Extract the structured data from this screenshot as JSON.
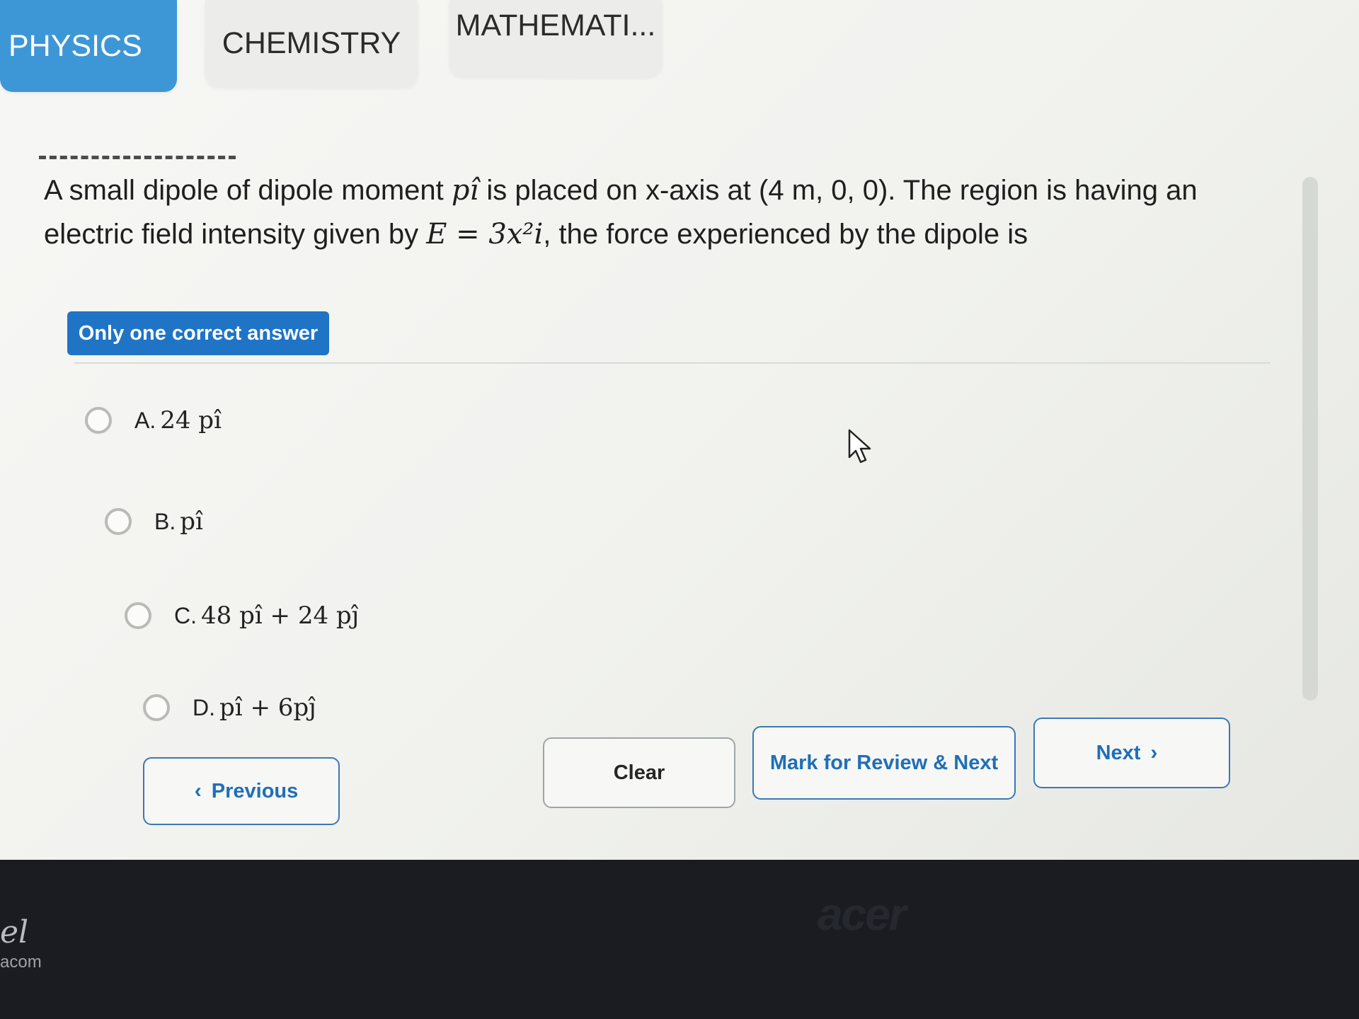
{
  "tabs": [
    {
      "label": "PHYSICS",
      "active": true
    },
    {
      "label": "CHEMISTRY",
      "active": false
    },
    {
      "label": "MATHEMATI...",
      "active": false
    }
  ],
  "question": {
    "text_1": "A small dipole of dipole moment ",
    "math_1": "pî",
    "text_2": " is placed on x-axis at (4 m, 0, 0). The region is having an electric field intensity given by ",
    "math_2": "E = 3x²i",
    "text_3": ", the force experienced by the dipole is"
  },
  "answer_type": "Only one correct answer",
  "options": [
    {
      "letter": "A.",
      "text": "24 pî"
    },
    {
      "letter": "B.",
      "text": "pî"
    },
    {
      "letter": "C.",
      "text": "48 pî + 24 pĵ"
    },
    {
      "letter": "D.",
      "text": "pî + 6pĵ"
    }
  ],
  "buttons": {
    "previous": "Previous",
    "clear": "Clear",
    "mark_review": "Mark for Review & Next",
    "next": "Next"
  },
  "bezel": {
    "brand": "acer",
    "sticker_top": "el",
    "sticker_bottom": "acom"
  },
  "colors": {
    "accent": "#3d97d6",
    "badge": "#1f74c6",
    "button_text": "#1f6fb8"
  }
}
